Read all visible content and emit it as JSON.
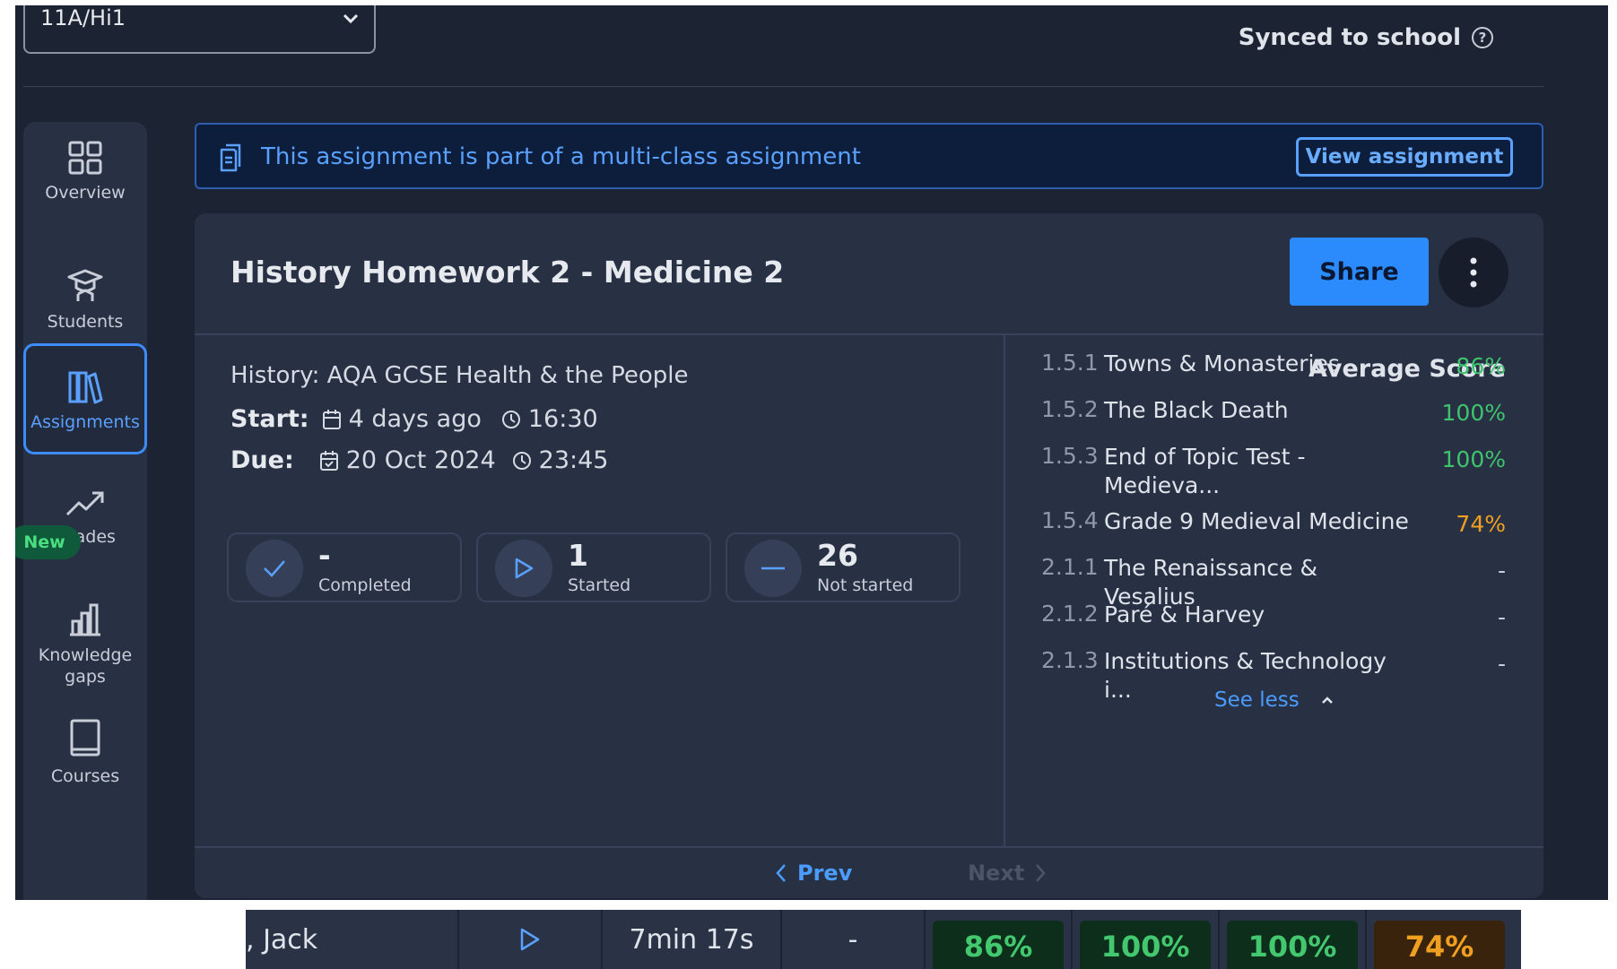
{
  "top_bar": {
    "class_selector_value": "11A/Hi1",
    "synced_label": "Synced to school",
    "help_symbol": "?"
  },
  "sidebar": {
    "items": [
      {
        "label": "Overview",
        "icon": "grid-icon"
      },
      {
        "label": "Students",
        "icon": "graduation-cap-icon"
      },
      {
        "label": "Assignments",
        "icon": "books-icon",
        "active": true
      },
      {
        "label": "Grades",
        "icon": "trend-up-icon"
      },
      {
        "label": "Knowledge gaps",
        "icon": "bar-chart-icon",
        "badge": "New"
      },
      {
        "label": "Courses",
        "icon": "book-icon"
      }
    ],
    "badge_text": "New"
  },
  "banner": {
    "text": "This assignment is part of a multi-class assignment",
    "button_label": "View assignment"
  },
  "assignment": {
    "title": "History Homework 2 - Medicine 2",
    "share_label": "Share",
    "course": "History: AQA GCSE Health & the People",
    "start_label": "Start:",
    "start_date": "4 days ago",
    "start_time": "16:30",
    "due_label": "Due:",
    "due_date": "20 Oct 2024",
    "due_time": "23:45"
  },
  "stats": [
    {
      "value": "-",
      "caption": "Completed",
      "icon": "check-icon"
    },
    {
      "value": "1",
      "caption": "Started",
      "icon": "play-icon"
    },
    {
      "value": "26",
      "caption": "Not started",
      "icon": "minus-icon"
    }
  ],
  "scores": {
    "header": "Average Score",
    "topics": [
      {
        "code": "1.5.1",
        "name": "Towns & Monasteries",
        "score": "86%",
        "tone": "green"
      },
      {
        "code": "1.5.2",
        "name": "The Black Death",
        "score": "100%",
        "tone": "green"
      },
      {
        "code": "1.5.3",
        "name": "End of Topic Test - Medieva...",
        "score": "100%",
        "tone": "green"
      },
      {
        "code": "1.5.4",
        "name": "Grade 9 Medieval Medicine",
        "score": "74%",
        "tone": "orange"
      },
      {
        "code": "2.1.1",
        "name": "The Renaissance & Vesalius",
        "score": "-",
        "tone": "none"
      },
      {
        "code": "2.1.2",
        "name": "Paré & Harvey",
        "score": "-",
        "tone": "none"
      },
      {
        "code": "2.1.3",
        "name": "Institutions & Technology i...",
        "score": "-",
        "tone": "none"
      }
    ],
    "see_less_label": "See less"
  },
  "pager": {
    "prev_label": "Prev",
    "next_label": "Next"
  },
  "student_row": {
    "name": ", Jack",
    "time": "7min 17s",
    "completed": "-",
    "scores": [
      "86%",
      "100%",
      "100%",
      "74%"
    ]
  },
  "colors": {
    "background": "#1c2333",
    "panel": "#283044",
    "accent": "#2b8bfc",
    "green": "#3ec46d",
    "orange": "#f0a020"
  }
}
